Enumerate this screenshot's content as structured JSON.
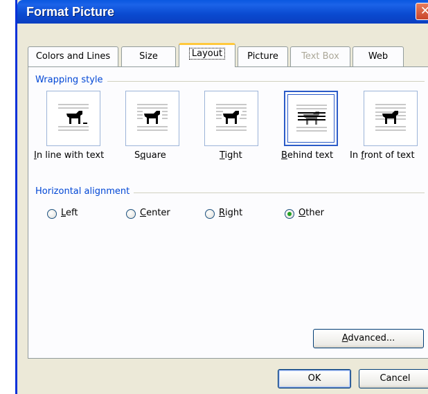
{
  "window": {
    "title": "Format Picture",
    "close_glyph": "✕"
  },
  "tabs": [
    {
      "label": "Colors and Lines",
      "state": "normal"
    },
    {
      "label": "Size",
      "state": "normal"
    },
    {
      "label": "Layout",
      "state": "active"
    },
    {
      "label": "Picture",
      "state": "normal"
    },
    {
      "label": "Text Box",
      "state": "disabled"
    },
    {
      "label": "Web",
      "state": "normal"
    }
  ],
  "wrapping": {
    "group_label": "Wrapping style",
    "options": [
      {
        "mnemonic": "I",
        "rest": "n line with text",
        "icon": "inline-wrap-icon",
        "selected": false
      },
      {
        "mnemonic": "",
        "pre": "S",
        "mnemonic2": "q",
        "rest": "uare",
        "icon": "square-wrap-icon",
        "selected": false
      },
      {
        "mnemonic": "T",
        "rest": "ight",
        "icon": "tight-wrap-icon",
        "selected": false
      },
      {
        "mnemonic": "B",
        "rest": "ehind text",
        "icon": "behind-text-icon",
        "selected": true
      },
      {
        "pre": "In ",
        "mnemonic": "f",
        "rest": "ront of text",
        "icon": "in-front-icon",
        "selected": false
      }
    ]
  },
  "alignment": {
    "group_label": "Horizontal alignment",
    "options": [
      {
        "mnemonic": "L",
        "rest": "eft",
        "checked": false
      },
      {
        "mnemonic": "C",
        "rest": "enter",
        "checked": false
      },
      {
        "mnemonic": "R",
        "rest": "ight",
        "checked": false
      },
      {
        "mnemonic": "O",
        "rest": "ther",
        "checked": true
      }
    ]
  },
  "buttons": {
    "advanced_mnemonic": "A",
    "advanced_rest": "dvanced...",
    "ok": "OK",
    "cancel": "Cancel"
  },
  "colors": {
    "titlebar": "#0a4ad0",
    "dialog_bg": "#ece9d8",
    "group_label": "#0046d5",
    "tab_highlight": "#ffc83c",
    "radio_checked": "#21a121"
  }
}
